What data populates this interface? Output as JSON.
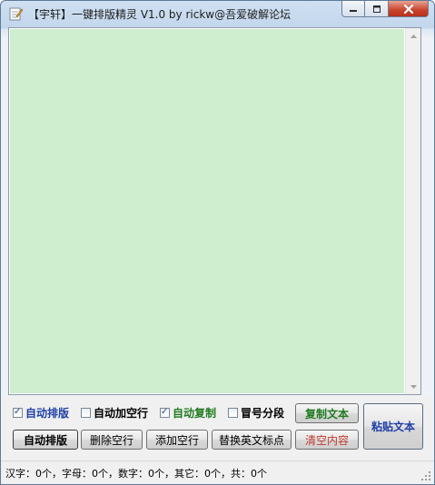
{
  "window": {
    "title": "【宇轩】一键排版精灵 V1.0 by rickw@吾爱破解论坛"
  },
  "options": [
    {
      "label": "自动排版",
      "checked": true,
      "color": "#1f3fa6",
      "bold": true
    },
    {
      "label": "自动加空行",
      "checked": false,
      "color": "#000000",
      "bold": true
    },
    {
      "label": "自动复制",
      "checked": true,
      "color": "#1f7a1f",
      "bold": true
    },
    {
      "label": "冒号分段",
      "checked": false,
      "color": "#000000",
      "bold": true
    }
  ],
  "buttons": {
    "copy_text": "复制文本",
    "paste_text": "粘贴文本",
    "auto_format": "自动排版",
    "delete_blank_lines": "删除空行",
    "add_blank_lines": "添加空行",
    "replace_punct": "替换英文标点",
    "clear_content": "清空内容"
  },
  "colors": {
    "editor_background": "#cfeed0",
    "copy_text": "#1f7a1f",
    "paste_text": "#1f3fa6",
    "clear_content": "#c0392b"
  },
  "status": {
    "text": "汉字：0个，字母：0个，数字：0个，其它：0个，共：0个"
  }
}
